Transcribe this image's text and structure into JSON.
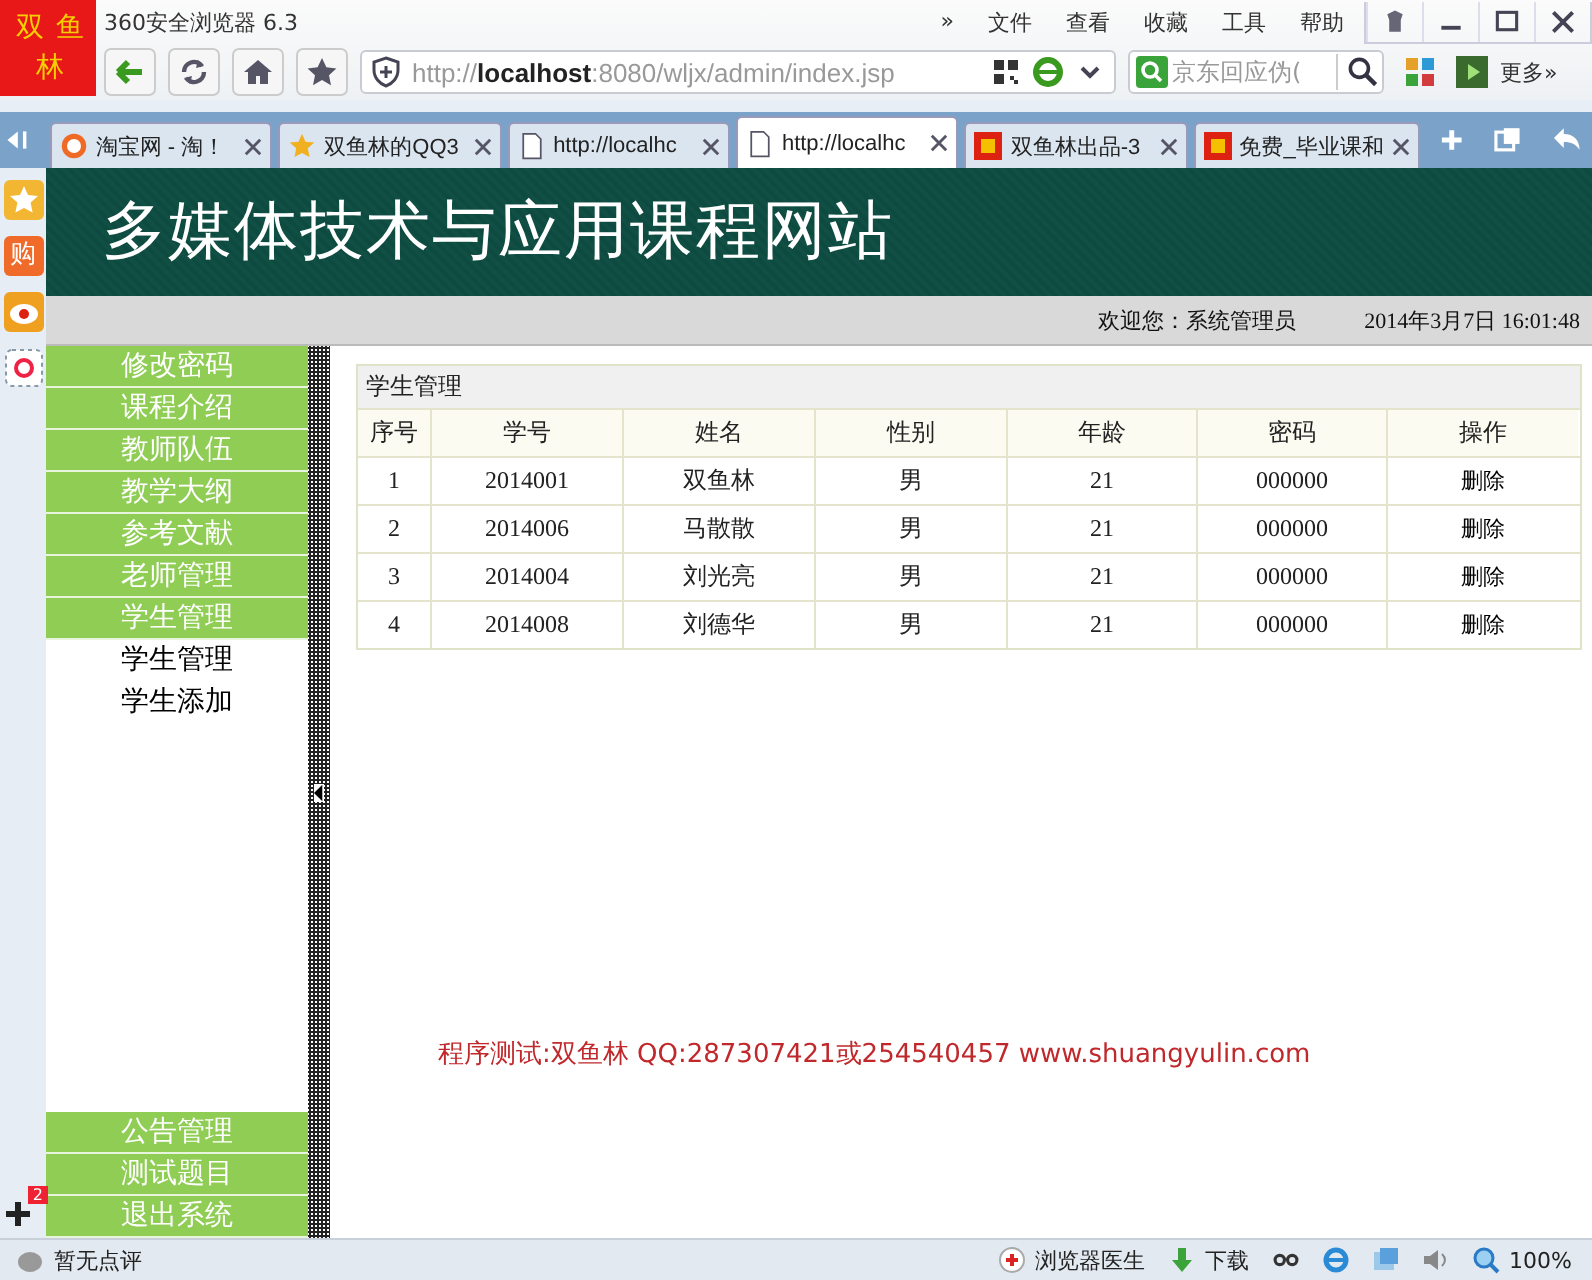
{
  "window": {
    "title": "360安全浏览器 6.3",
    "logo": "双鱼林"
  },
  "menu_bar": [
    "»",
    "文件",
    "查看",
    "收藏",
    "工具",
    "帮助"
  ],
  "toolbar": {
    "address": {
      "scheme": "http://",
      "host": "localhost",
      "path": ":8080/wljx/admin/index.jsp"
    },
    "search": {
      "placeholder": "京东回应伪("
    },
    "more": "更多»"
  },
  "tabs": [
    {
      "label": "淘宝网 - 淘！",
      "selected": false
    },
    {
      "label": "双鱼林的QQ3",
      "selected": false
    },
    {
      "label": "http://localhc",
      "selected": false
    },
    {
      "label": "http://localhc",
      "selected": true
    },
    {
      "label": "双鱼林出品-3",
      "selected": false
    },
    {
      "label": "免费_毕业课和",
      "selected": false
    }
  ],
  "side_strip": {
    "icon_label": "购",
    "badge": "2"
  },
  "site": {
    "title": "多媒体技术与应用课程网站",
    "welcome": "欢迎您：系统管理员",
    "datetime": "2014年3月7日  16:01:48"
  },
  "nav": [
    {
      "label": "修改密码"
    },
    {
      "label": "课程介绍"
    },
    {
      "label": "教师队伍"
    },
    {
      "label": "教学大纲"
    },
    {
      "label": "参考文献"
    },
    {
      "label": "老师管理"
    },
    {
      "label": "学生管理",
      "expanded": true,
      "children": [
        {
          "label": "学生管理"
        },
        {
          "label": "学生添加"
        }
      ]
    }
  ],
  "nav_bottom": [
    {
      "label": "公告管理"
    },
    {
      "label": "测试题目"
    },
    {
      "label": "退出系统"
    }
  ],
  "table": {
    "caption": "学生管理",
    "columns": [
      "序号",
      "学号",
      "姓名",
      "性别",
      "年龄",
      "密码",
      "操作"
    ],
    "rows": [
      [
        "1",
        "2014001",
        "双鱼林",
        "男",
        "21",
        "000000",
        "删除"
      ],
      [
        "2",
        "2014006",
        "马散散",
        "男",
        "21",
        "000000",
        "删除"
      ],
      [
        "3",
        "2014004",
        "刘光亮",
        "男",
        "21",
        "000000",
        "删除"
      ],
      [
        "4",
        "2014008",
        "刘德华",
        "男",
        "21",
        "000000",
        "删除"
      ]
    ]
  },
  "footer": "程序测试:双鱼林 QQ:287307421或254540457 www.shuangyulin.com",
  "status_bar": {
    "left": "暂无点评",
    "doctor": "浏览器医生",
    "download": "下载",
    "zoom": "100%"
  }
}
